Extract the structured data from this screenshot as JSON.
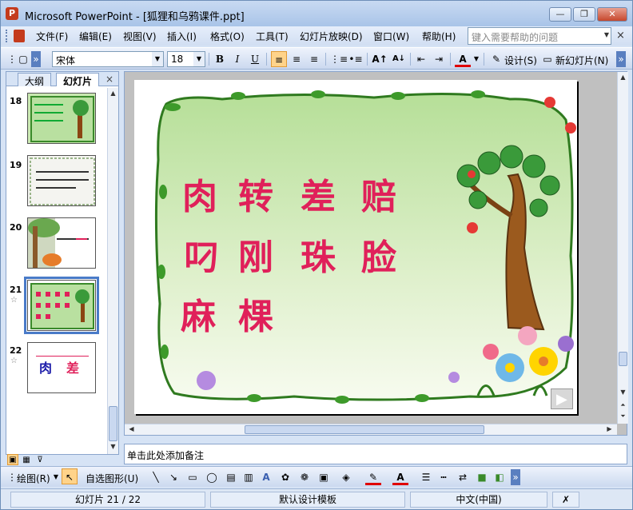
{
  "window": {
    "title": "Microsoft PowerPoint - [狐狸和乌鸦课件.ppt]",
    "app_icon": "P"
  },
  "titlebar_buttons": {
    "minimize": "—",
    "restore": "❐",
    "close": "✕"
  },
  "menu": {
    "items": [
      "文件(F)",
      "编辑(E)",
      "视图(V)",
      "插入(I)",
      "格式(O)",
      "工具(T)",
      "幻灯片放映(D)",
      "窗口(W)",
      "帮助(H)"
    ],
    "help_placeholder": "键入需要帮助的问题",
    "close": "×"
  },
  "toolbar": {
    "font_name": "宋体",
    "font_size": "18",
    "bold": "B",
    "italic": "I",
    "underline": "U",
    "design_label": "设计(S)",
    "new_slide_label": "新幻灯片(N)"
  },
  "left_pane": {
    "tabs": [
      "大纲",
      "幻灯片"
    ],
    "active_tab": "幻灯片",
    "close": "×",
    "thumbnails": [
      {
        "number": "18",
        "selected": false,
        "has_star": false
      },
      {
        "number": "19",
        "selected": false,
        "has_star": false
      },
      {
        "number": "20",
        "selected": false,
        "has_star": false
      },
      {
        "number": "21",
        "selected": true,
        "has_star": true
      },
      {
        "number": "22",
        "selected": false,
        "has_star": true
      }
    ],
    "thumb22_text": [
      "肉",
      "差"
    ]
  },
  "slide": {
    "lines": [
      [
        "肉",
        "转",
        "差",
        "赔"
      ],
      [
        "叼",
        "刚",
        "珠",
        "脸"
      ],
      [
        "麻",
        "棵"
      ]
    ],
    "next_button": "▶"
  },
  "notes": {
    "placeholder": "单击此处添加备注"
  },
  "drawing_toolbar": {
    "draw_label": "绘图(R)",
    "autoshapes_label": "自选图形(U)"
  },
  "status": {
    "slide_position": "幻灯片 21 / 22",
    "design_template": "默认设计模板",
    "language": "中文(中国)"
  },
  "colors": {
    "slide_text": "#e0205a",
    "frame_green": "#b9e0a0",
    "accent": "#4a7bc8"
  }
}
